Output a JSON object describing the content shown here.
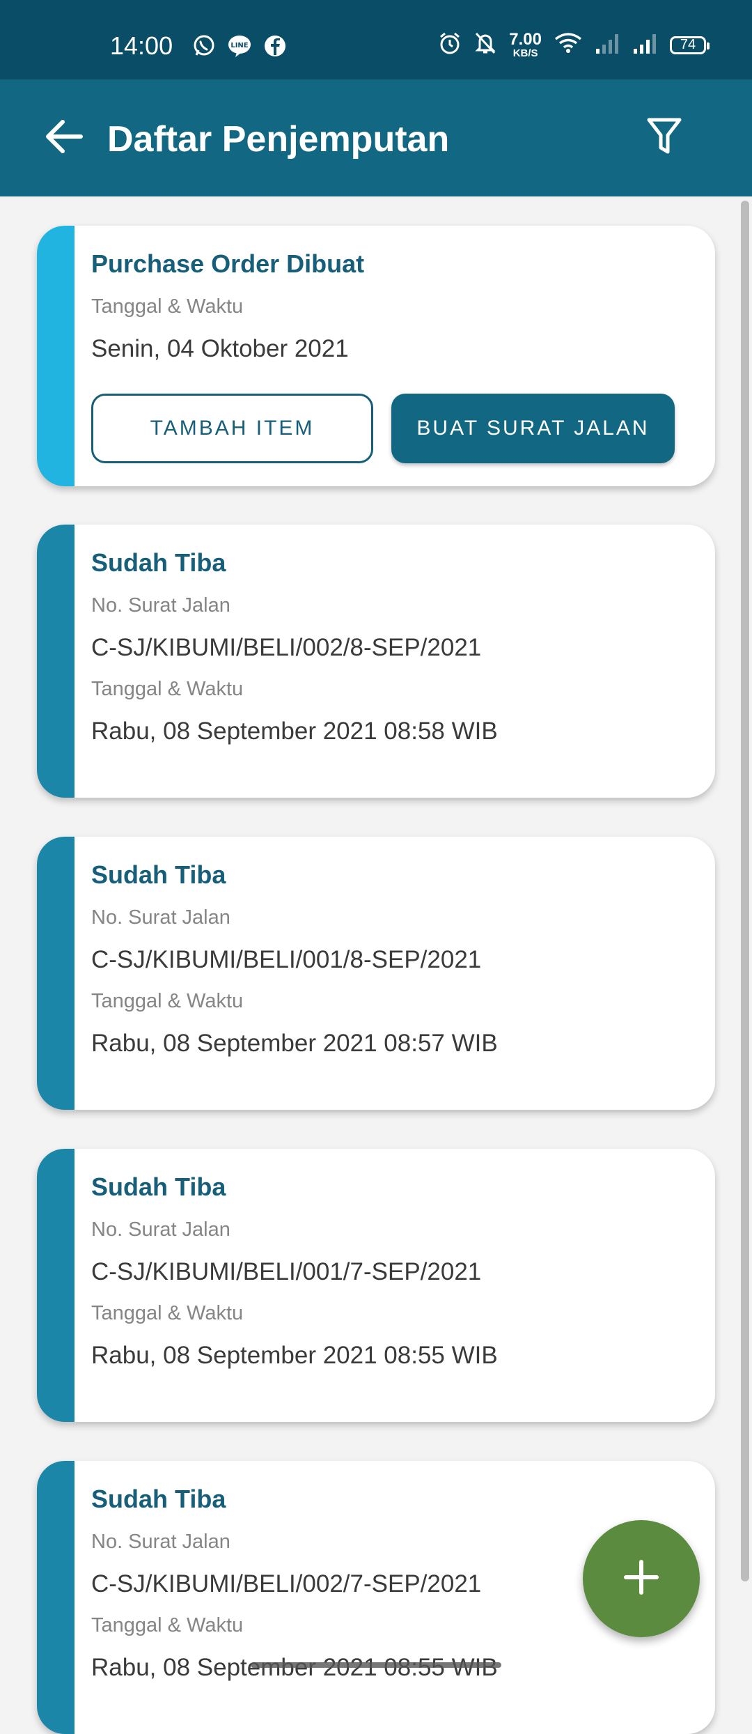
{
  "status_bar": {
    "time": "14:00",
    "left_icons": [
      "whatsapp-icon",
      "line-icon",
      "facebook-icon"
    ],
    "speed_value": "7.00",
    "speed_unit": "KB/S",
    "battery": "74"
  },
  "app_bar": {
    "title": "Daftar Penjemputan",
    "back_icon": "arrow-left-icon",
    "filter_icon": "filter-icon",
    "background": "#126783"
  },
  "cards": [
    {
      "status": "Purchase Order Dibuat",
      "date_label": "Tanggal & Waktu",
      "date_value": "Senin, 04 Oktober 2021",
      "accent": "#22b4e0",
      "buttons": {
        "add_item": "TAMBAH ITEM",
        "create_letter": "BUAT SURAT JALAN"
      }
    },
    {
      "status": "Sudah Tiba",
      "doc_label": "No. Surat Jalan",
      "doc_value": "C-SJ/KIBUMI/BELI/002/8-SEP/2021",
      "date_label": "Tanggal & Waktu",
      "date_value": "Rabu, 08 September 2021 08:58 WIB",
      "accent": "#1b86a8"
    },
    {
      "status": "Sudah Tiba",
      "doc_label": "No. Surat Jalan",
      "doc_value": "C-SJ/KIBUMI/BELI/001/8-SEP/2021",
      "date_label": "Tanggal & Waktu",
      "date_value": "Rabu, 08 September 2021 08:57 WIB",
      "accent": "#1b86a8"
    },
    {
      "status": "Sudah Tiba",
      "doc_label": "No. Surat Jalan",
      "doc_value": "C-SJ/KIBUMI/BELI/001/7-SEP/2021",
      "date_label": "Tanggal & Waktu",
      "date_value": "Rabu, 08 September 2021 08:55 WIB",
      "accent": "#1b86a8"
    },
    {
      "status": "Sudah Tiba",
      "doc_label": "No. Surat Jalan",
      "doc_value": "C-SJ/KIBUMI/BELI/002/7-SEP/2021",
      "date_label": "Tanggal & Waktu",
      "date_value": "Rabu, 08 September 2021 08:55 WIB",
      "accent": "#1b86a8"
    }
  ],
  "fab": {
    "icon": "plus-icon",
    "color": "#5b8b3e"
  }
}
